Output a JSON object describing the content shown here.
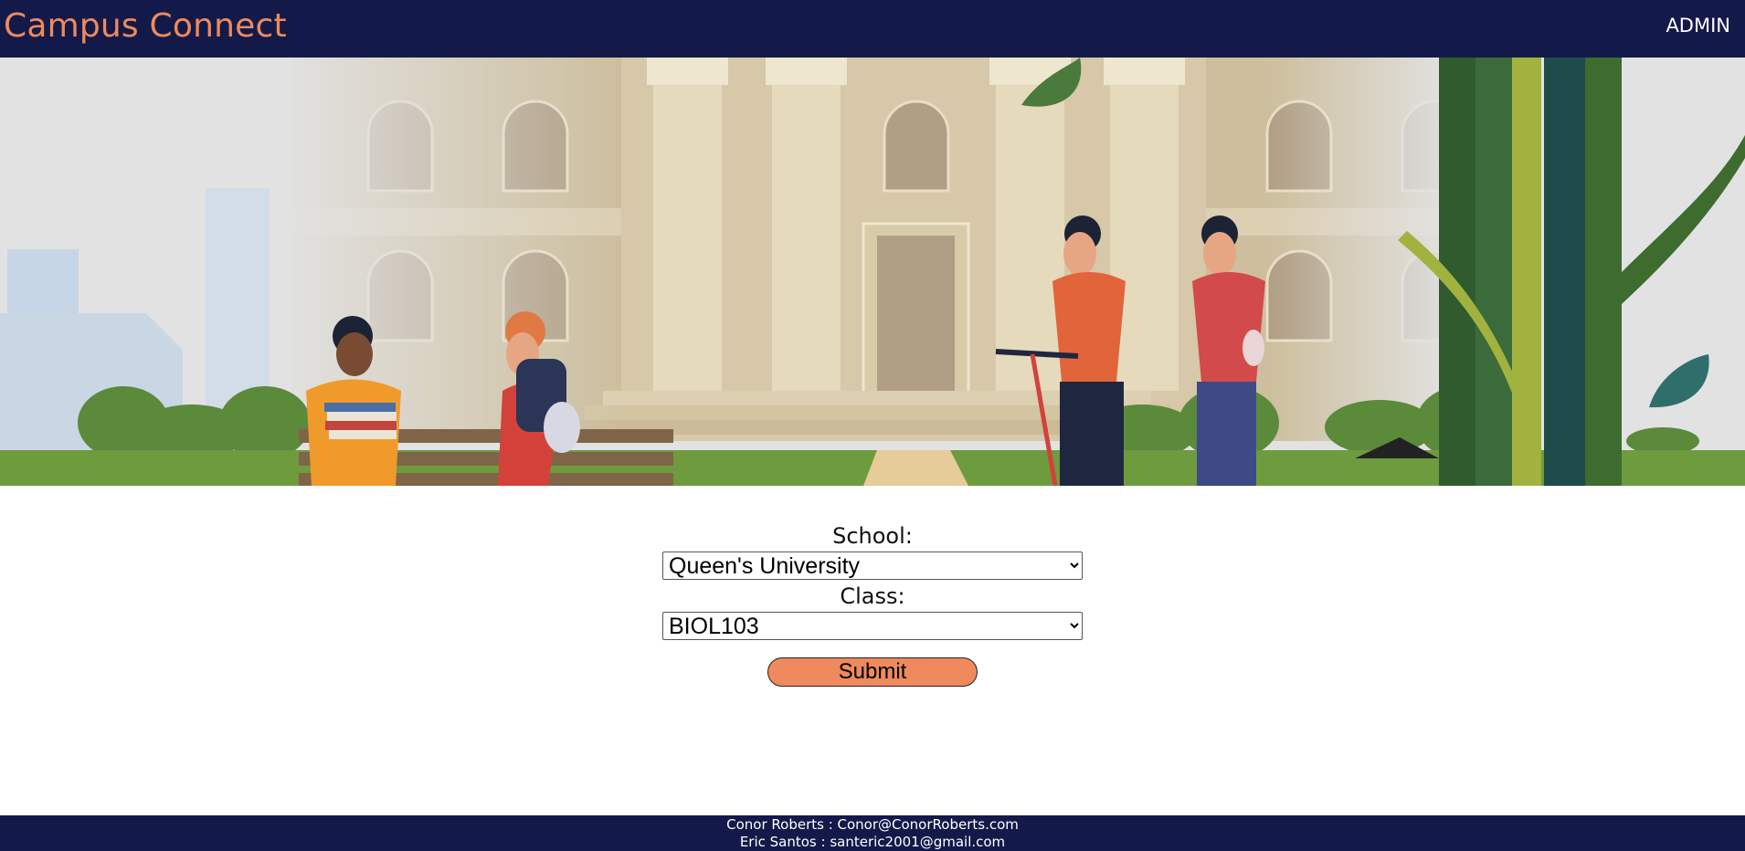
{
  "header": {
    "brand": "Campus Connect",
    "admin_link": "ADMIN",
    "brand_color": "#ee8a5d",
    "nav_bg": "#131a49"
  },
  "form": {
    "school_label": "School:",
    "school_value": "Queen's University",
    "class_label": "Class:",
    "class_value": "BIOL103",
    "submit_label": "Submit"
  },
  "footer": {
    "line1": "Conor Roberts : Conor@ConorRoberts.com",
    "line2": "Eric Santos : santeric2001@gmail.com"
  }
}
